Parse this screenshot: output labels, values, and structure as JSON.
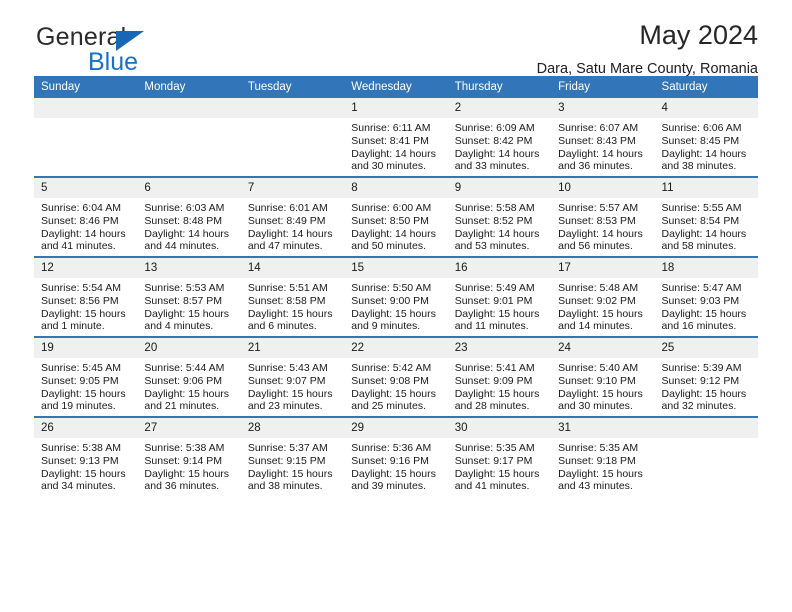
{
  "brand": {
    "name_top": "General",
    "name_bottom": "Blue",
    "triangle_color": "#1667b4",
    "blue_text_color": "#1771c5"
  },
  "header": {
    "title": "May 2024",
    "subtitle": "Dara, Satu Mare County, Romania"
  },
  "theme": {
    "header_bg": "#3275b8",
    "header_text": "#ffffff",
    "daynum_bg": "#f0f0f0",
    "cell_bg": "#ffffff",
    "row_divider": "#3275b8"
  },
  "weekdays": [
    "Sunday",
    "Monday",
    "Tuesday",
    "Wednesday",
    "Thursday",
    "Friday",
    "Saturday"
  ],
  "labels": {
    "sunrise": "Sunrise:",
    "sunset": "Sunset:",
    "daylight": "Daylight:"
  },
  "weeks": [
    [
      {
        "day": "",
        "empty": true
      },
      {
        "day": "",
        "empty": true
      },
      {
        "day": "",
        "empty": true
      },
      {
        "day": "1",
        "sunrise": "Sunrise: 6:11 AM",
        "sunset": "Sunset: 8:41 PM",
        "daylight": "Daylight: 14 hours and 30 minutes."
      },
      {
        "day": "2",
        "sunrise": "Sunrise: 6:09 AM",
        "sunset": "Sunset: 8:42 PM",
        "daylight": "Daylight: 14 hours and 33 minutes."
      },
      {
        "day": "3",
        "sunrise": "Sunrise: 6:07 AM",
        "sunset": "Sunset: 8:43 PM",
        "daylight": "Daylight: 14 hours and 36 minutes."
      },
      {
        "day": "4",
        "sunrise": "Sunrise: 6:06 AM",
        "sunset": "Sunset: 8:45 PM",
        "daylight": "Daylight: 14 hours and 38 minutes."
      }
    ],
    [
      {
        "day": "5",
        "sunrise": "Sunrise: 6:04 AM",
        "sunset": "Sunset: 8:46 PM",
        "daylight": "Daylight: 14 hours and 41 minutes."
      },
      {
        "day": "6",
        "sunrise": "Sunrise: 6:03 AM",
        "sunset": "Sunset: 8:48 PM",
        "daylight": "Daylight: 14 hours and 44 minutes."
      },
      {
        "day": "7",
        "sunrise": "Sunrise: 6:01 AM",
        "sunset": "Sunset: 8:49 PM",
        "daylight": "Daylight: 14 hours and 47 minutes."
      },
      {
        "day": "8",
        "sunrise": "Sunrise: 6:00 AM",
        "sunset": "Sunset: 8:50 PM",
        "daylight": "Daylight: 14 hours and 50 minutes."
      },
      {
        "day": "9",
        "sunrise": "Sunrise: 5:58 AM",
        "sunset": "Sunset: 8:52 PM",
        "daylight": "Daylight: 14 hours and 53 minutes."
      },
      {
        "day": "10",
        "sunrise": "Sunrise: 5:57 AM",
        "sunset": "Sunset: 8:53 PM",
        "daylight": "Daylight: 14 hours and 56 minutes."
      },
      {
        "day": "11",
        "sunrise": "Sunrise: 5:55 AM",
        "sunset": "Sunset: 8:54 PM",
        "daylight": "Daylight: 14 hours and 58 minutes."
      }
    ],
    [
      {
        "day": "12",
        "sunrise": "Sunrise: 5:54 AM",
        "sunset": "Sunset: 8:56 PM",
        "daylight": "Daylight: 15 hours and 1 minute."
      },
      {
        "day": "13",
        "sunrise": "Sunrise: 5:53 AM",
        "sunset": "Sunset: 8:57 PM",
        "daylight": "Daylight: 15 hours and 4 minutes."
      },
      {
        "day": "14",
        "sunrise": "Sunrise: 5:51 AM",
        "sunset": "Sunset: 8:58 PM",
        "daylight": "Daylight: 15 hours and 6 minutes."
      },
      {
        "day": "15",
        "sunrise": "Sunrise: 5:50 AM",
        "sunset": "Sunset: 9:00 PM",
        "daylight": "Daylight: 15 hours and 9 minutes."
      },
      {
        "day": "16",
        "sunrise": "Sunrise: 5:49 AM",
        "sunset": "Sunset: 9:01 PM",
        "daylight": "Daylight: 15 hours and 11 minutes."
      },
      {
        "day": "17",
        "sunrise": "Sunrise: 5:48 AM",
        "sunset": "Sunset: 9:02 PM",
        "daylight": "Daylight: 15 hours and 14 minutes."
      },
      {
        "day": "18",
        "sunrise": "Sunrise: 5:47 AM",
        "sunset": "Sunset: 9:03 PM",
        "daylight": "Daylight: 15 hours and 16 minutes."
      }
    ],
    [
      {
        "day": "19",
        "sunrise": "Sunrise: 5:45 AM",
        "sunset": "Sunset: 9:05 PM",
        "daylight": "Daylight: 15 hours and 19 minutes."
      },
      {
        "day": "20",
        "sunrise": "Sunrise: 5:44 AM",
        "sunset": "Sunset: 9:06 PM",
        "daylight": "Daylight: 15 hours and 21 minutes."
      },
      {
        "day": "21",
        "sunrise": "Sunrise: 5:43 AM",
        "sunset": "Sunset: 9:07 PM",
        "daylight": "Daylight: 15 hours and 23 minutes."
      },
      {
        "day": "22",
        "sunrise": "Sunrise: 5:42 AM",
        "sunset": "Sunset: 9:08 PM",
        "daylight": "Daylight: 15 hours and 25 minutes."
      },
      {
        "day": "23",
        "sunrise": "Sunrise: 5:41 AM",
        "sunset": "Sunset: 9:09 PM",
        "daylight": "Daylight: 15 hours and 28 minutes."
      },
      {
        "day": "24",
        "sunrise": "Sunrise: 5:40 AM",
        "sunset": "Sunset: 9:10 PM",
        "daylight": "Daylight: 15 hours and 30 minutes."
      },
      {
        "day": "25",
        "sunrise": "Sunrise: 5:39 AM",
        "sunset": "Sunset: 9:12 PM",
        "daylight": "Daylight: 15 hours and 32 minutes."
      }
    ],
    [
      {
        "day": "26",
        "sunrise": "Sunrise: 5:38 AM",
        "sunset": "Sunset: 9:13 PM",
        "daylight": "Daylight: 15 hours and 34 minutes."
      },
      {
        "day": "27",
        "sunrise": "Sunrise: 5:38 AM",
        "sunset": "Sunset: 9:14 PM",
        "daylight": "Daylight: 15 hours and 36 minutes."
      },
      {
        "day": "28",
        "sunrise": "Sunrise: 5:37 AM",
        "sunset": "Sunset: 9:15 PM",
        "daylight": "Daylight: 15 hours and 38 minutes."
      },
      {
        "day": "29",
        "sunrise": "Sunrise: 5:36 AM",
        "sunset": "Sunset: 9:16 PM",
        "daylight": "Daylight: 15 hours and 39 minutes."
      },
      {
        "day": "30",
        "sunrise": "Sunrise: 5:35 AM",
        "sunset": "Sunset: 9:17 PM",
        "daylight": "Daylight: 15 hours and 41 minutes."
      },
      {
        "day": "31",
        "sunrise": "Sunrise: 5:35 AM",
        "sunset": "Sunset: 9:18 PM",
        "daylight": "Daylight: 15 hours and 43 minutes."
      },
      {
        "day": "",
        "empty": true
      }
    ]
  ]
}
